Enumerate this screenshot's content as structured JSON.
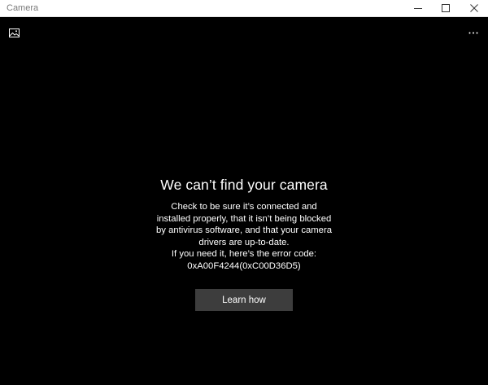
{
  "window": {
    "title": "Camera"
  },
  "titlebar": {
    "minimize_icon": "minimize-icon",
    "maximize_icon": "maximize-icon",
    "close_icon": "close-icon"
  },
  "appbar": {
    "gallery_icon": "photo-gallery-icon",
    "more_icon": "more-options-icon"
  },
  "error": {
    "title": "We can’t find your camera",
    "lines": [
      "Check to be sure it’s connected and",
      "installed properly, that it isn’t being blocked",
      "by antivirus software, and that your camera",
      "drivers are up-to-date.",
      "If you need it, here’s the error code:",
      "0xA00F4244(0xC00D36D5)"
    ],
    "button_label": "Learn how"
  },
  "colors": {
    "background": "#000000",
    "titlebar": "#ffffff",
    "button": "#3d3d3d",
    "text": "#ffffff"
  }
}
